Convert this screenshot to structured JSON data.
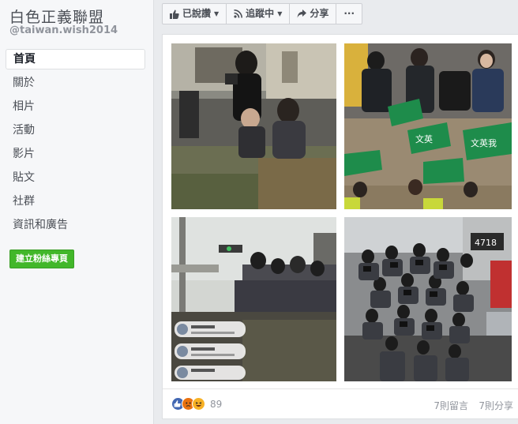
{
  "page": {
    "name": "白色正義聯盟",
    "handle": "@taiwan.wish2014"
  },
  "sidebar": {
    "items": [
      {
        "label": "首頁",
        "active": true
      },
      {
        "label": "關於"
      },
      {
        "label": "相片"
      },
      {
        "label": "活動"
      },
      {
        "label": "影片"
      },
      {
        "label": "貼文"
      },
      {
        "label": "社群"
      },
      {
        "label": "資訊和廣告"
      }
    ],
    "create_button": "建立粉絲專頁"
  },
  "toolbar": {
    "liked_label": "已說讚",
    "following_label": "追蹤中",
    "share_label": "分享",
    "more_label": "···"
  },
  "post": {
    "photo_sign_text": "文英",
    "photo_sign_text_2": "文英我",
    "photo_number": "4718",
    "reaction_count": "89",
    "comments": "7則留言",
    "shares": "7則分享"
  },
  "colors": {
    "fb_blue": "#4267b2",
    "fan_page_green": "#42b72a",
    "dpp_green": "#1e8c4b"
  }
}
